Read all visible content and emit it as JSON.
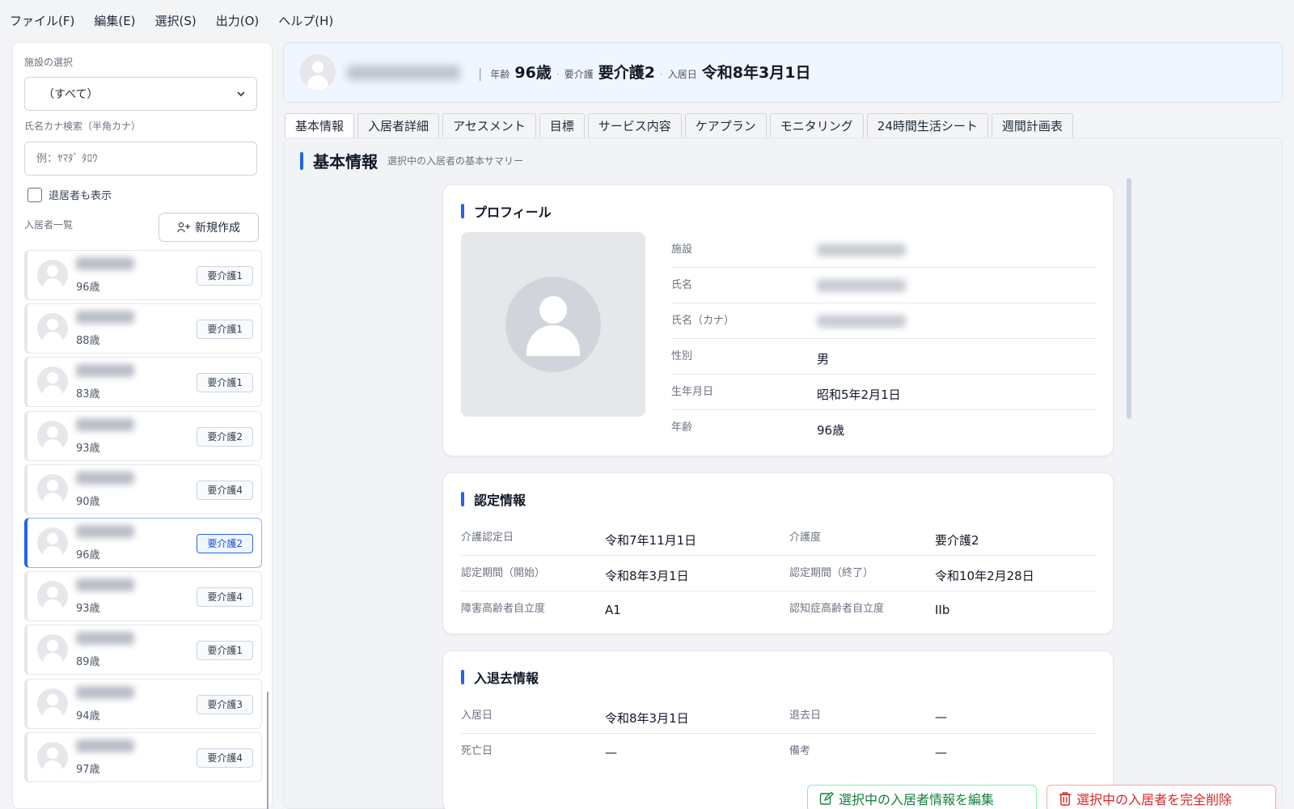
{
  "menu": [
    "ファイル(F)",
    "編集(E)",
    "選択(S)",
    "出力(O)",
    "ヘルプ(H)"
  ],
  "sidebar": {
    "facility_label": "施設の選択",
    "facility_value": "（すべて）",
    "kana_label": "氏名カナ検索（半角カナ）",
    "kana_placeholder": "例：ﾔﾏﾀﾞ ﾀﾛｳ",
    "show_retired_label": "退居者も表示",
    "list_label": "入居者一覧",
    "new_button": "新規作成",
    "residents": [
      {
        "age": "96歳",
        "care": "要介護1"
      },
      {
        "age": "88歳",
        "care": "要介護1"
      },
      {
        "age": "83歳",
        "care": "要介護1"
      },
      {
        "age": "93歳",
        "care": "要介護2"
      },
      {
        "age": "90歳",
        "care": "要介護4"
      },
      {
        "age": "96歳",
        "care": "要介護2"
      },
      {
        "age": "93歳",
        "care": "要介護4"
      },
      {
        "age": "89歳",
        "care": "要介護1"
      },
      {
        "age": "94歳",
        "care": "要介護3"
      },
      {
        "age": "97歳",
        "care": "要介護4"
      }
    ],
    "selected_index": 5
  },
  "header": {
    "age_label": "年齢",
    "age_value": "96歳",
    "care_label": "要介護",
    "care_value": "要介護2",
    "move_in_label": "入居日",
    "move_in_value": "令和8年3月1日"
  },
  "tabs": [
    "基本情報",
    "入居者詳細",
    "アセスメント",
    "目標",
    "サービス内容",
    "ケアプラン",
    "モニタリング",
    "24時間生活シート",
    "週間計画表"
  ],
  "active_tab": 0,
  "section": {
    "title": "基本情報",
    "subtitle": "選択中の入居者の基本サマリー"
  },
  "profile": {
    "title": "プロフィール",
    "rows": [
      {
        "key": "施設",
        "value": null
      },
      {
        "key": "氏名",
        "value": null
      },
      {
        "key": "氏名（カナ）",
        "value": null
      },
      {
        "key": "性別",
        "value": "男"
      },
      {
        "key": "生年月日",
        "value": "昭和5年2月1日"
      },
      {
        "key": "年齢",
        "value": "96歳"
      }
    ]
  },
  "certification": {
    "title": "認定情報",
    "rows": [
      {
        "k1": "介護認定日",
        "v1": "令和7年11月1日",
        "k2": "介護度",
        "v2": "要介護2"
      },
      {
        "k1": "認定期間（開始）",
        "v1": "令和8年3月1日",
        "k2": "認定期間（終了）",
        "v2": "令和10年2月28日"
      },
      {
        "k1": "障害高齢者自立度",
        "v1": "A1",
        "k2": "認知症高齢者自立度",
        "v2": "IIb"
      }
    ]
  },
  "moving": {
    "title": "入退去情報",
    "rows": [
      {
        "k1": "入居日",
        "v1": "令和8年3月1日",
        "k2": "退去日",
        "v2": "—"
      },
      {
        "k1": "死亡日",
        "v1": "—",
        "k2": "備考",
        "v2": "—"
      }
    ]
  },
  "actions": {
    "edit": "選択中の入居者情報を編集",
    "delete": "選択中の入居者を完全削除"
  },
  "colors": {
    "accent": "#2563eb",
    "edit": "#15803d",
    "delete": "#dc2626"
  }
}
